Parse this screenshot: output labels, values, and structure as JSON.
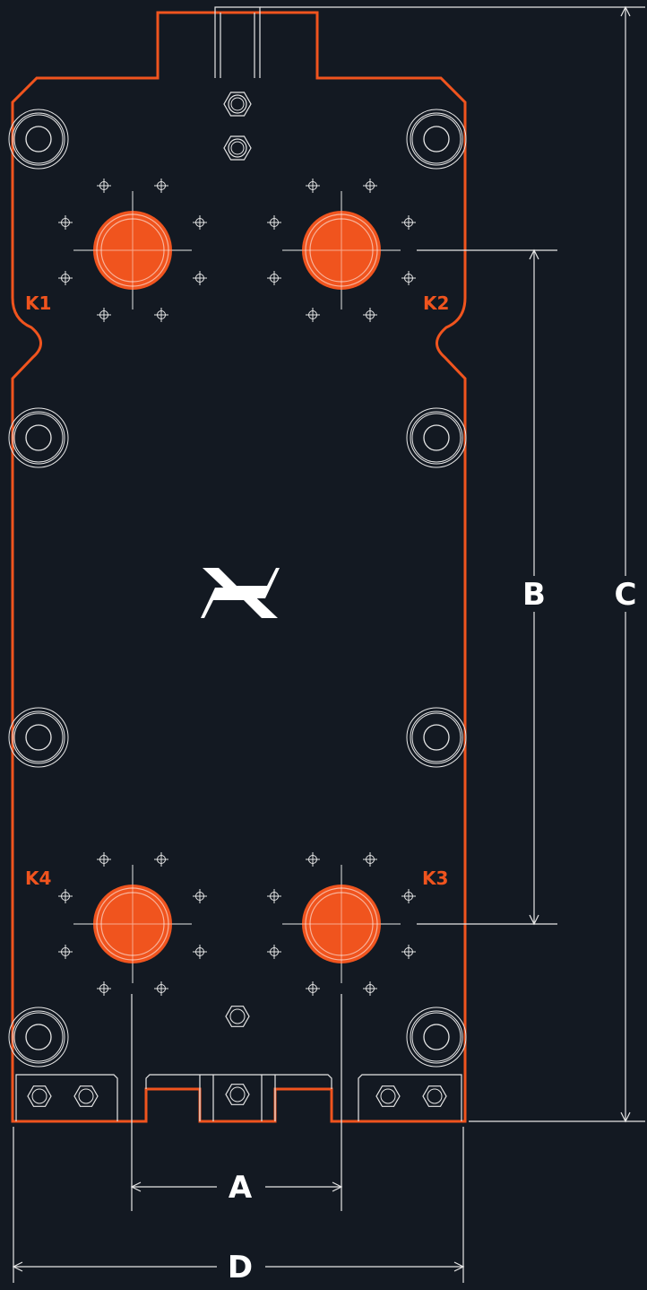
{
  "colors": {
    "background": "#131922",
    "outline": "#f0541e",
    "port": "#f0541e",
    "line": "#e6e6e6",
    "text": "#ffffff"
  },
  "icons": [
    "bolt-hole-icon",
    "logo-icon",
    "crosshair-icon"
  ],
  "ports": [
    {
      "id": "k1",
      "label": "K1"
    },
    {
      "id": "k2",
      "label": "K2"
    },
    {
      "id": "k3",
      "label": "K3"
    },
    {
      "id": "k4",
      "label": "K4"
    }
  ],
  "dimensions": {
    "a": "A",
    "b": "B",
    "c": "C",
    "d": "D"
  }
}
